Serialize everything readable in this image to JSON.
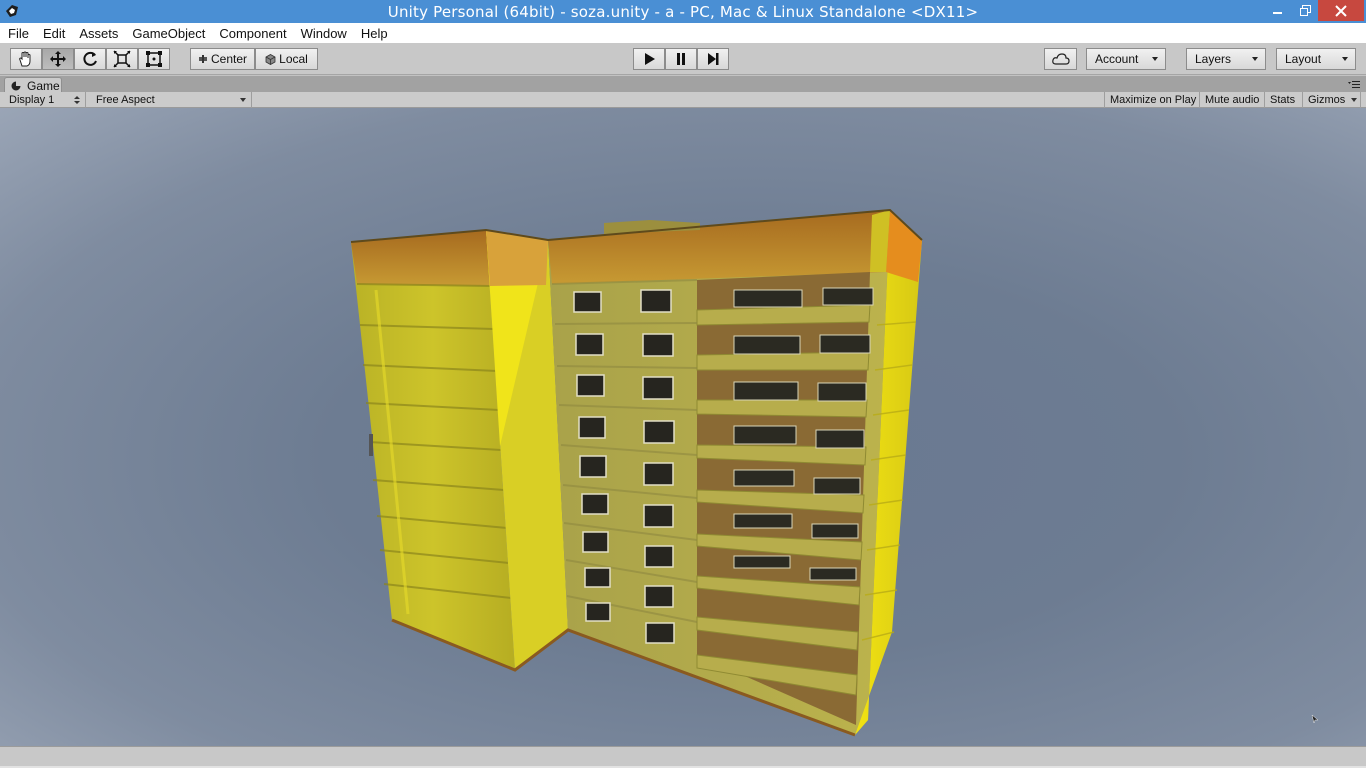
{
  "window": {
    "title": "Unity Personal (64bit) - soza.unity - a - PC, Mac & Linux Standalone <DX11>"
  },
  "menu": [
    "File",
    "Edit",
    "Assets",
    "GameObject",
    "Component",
    "Window",
    "Help"
  ],
  "toolbar": {
    "transform_tools": [
      {
        "name": "hand-tool",
        "icon": "hand-icon",
        "active": false
      },
      {
        "name": "move-tool",
        "icon": "move-arrows-icon",
        "active": true
      },
      {
        "name": "rotate-tool",
        "icon": "rotate-icon",
        "active": false
      },
      {
        "name": "scale-tool",
        "icon": "scale-icon",
        "active": false
      },
      {
        "name": "rect-tool",
        "icon": "rect-transform-icon",
        "active": false
      }
    ],
    "pivot_label": "Center",
    "space_label": "Local",
    "cloud_icon": "cloud-icon",
    "account_label": "Account",
    "layers_label": "Layers",
    "layout_label": "Layout"
  },
  "game_tab": {
    "label": "Game",
    "display": "Display 1",
    "aspect": "Free Aspect",
    "maximize": "Maximize on Play",
    "mute": "Mute audio",
    "stats": "Stats",
    "gizmos": "Gizmos"
  },
  "colors": {
    "title_bar": "#4a8fd4",
    "close_button": "#c7483f",
    "building_wall": "#c9c12a",
    "building_bright": "#ecdc17",
    "roof_band": "#c8902e"
  }
}
